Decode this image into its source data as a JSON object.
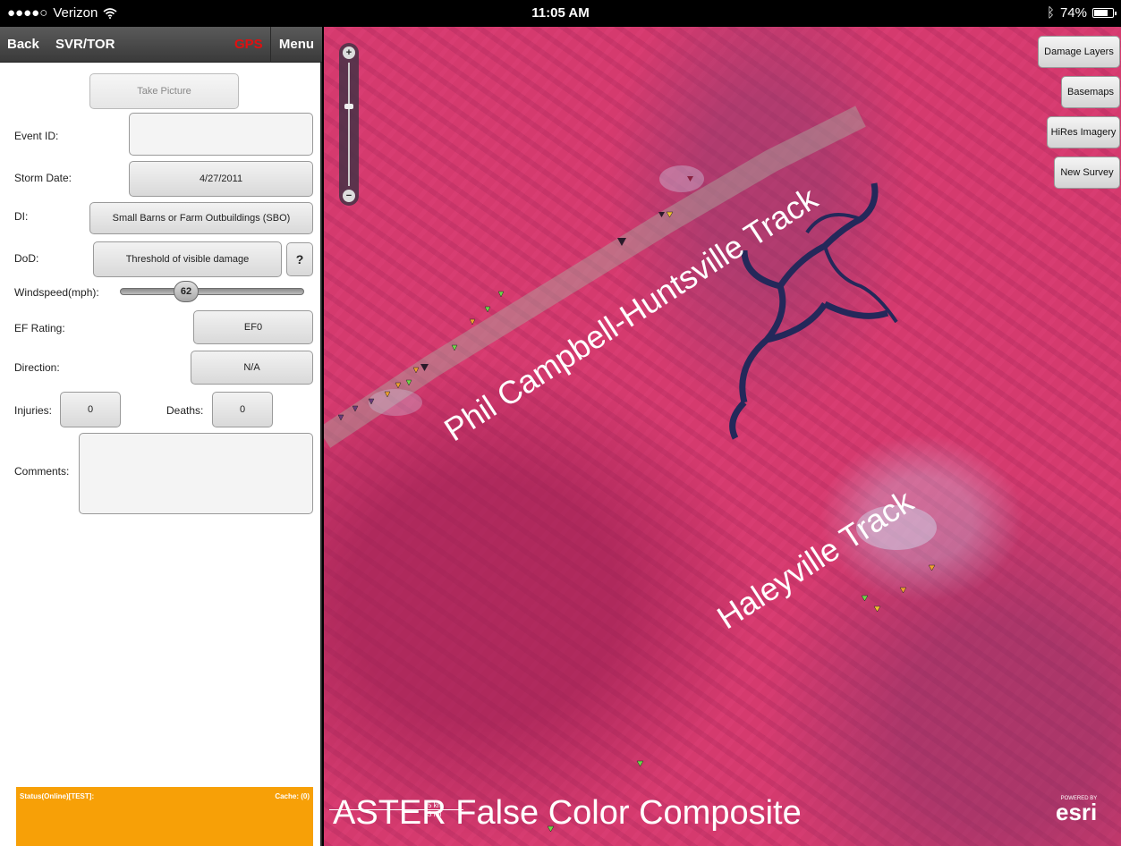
{
  "status_bar": {
    "signal": "●●●●○",
    "carrier": "Verizon",
    "wifi_icon": "wifi-icon",
    "time": "11:05 AM",
    "bluetooth": "ᛒ",
    "battery": "74%",
    "battery_level": 0.74
  },
  "nav": {
    "back": "Back",
    "title": "SVR/TOR",
    "gps": "GPS",
    "menu": "Menu"
  },
  "form": {
    "take_picture": "Take Picture",
    "event_id_label": "Event ID:",
    "event_id_value": "",
    "storm_date_label": "Storm Date:",
    "storm_date_value": "4/27/2011",
    "di_label": "DI:",
    "di_value": "Small Barns or Farm Outbuildings (SBO)",
    "dod_label": "DoD:",
    "dod_value": "Threshold of visible damage",
    "dod_help": "?",
    "windspeed_label": "Windspeed(mph):",
    "windspeed_value": "62",
    "ef_label": "EF Rating:",
    "ef_value": "EF0",
    "direction_label": "Direction:",
    "direction_value": "N/A",
    "injuries_label": "Injuries:",
    "injuries_value": "0",
    "deaths_label": "Deaths:",
    "deaths_value": "0",
    "comments_label": "Comments:",
    "comments_value": ""
  },
  "footer": {
    "status": "Status(Online)[TEST]:",
    "cache": "Cache: (0)",
    "color": "#f7a007"
  },
  "map": {
    "buttons": {
      "damage_layers": "Damage Layers",
      "basemaps": "Basemaps",
      "hires": "HiRes Imagery",
      "new_survey": "New Survey"
    },
    "track1": "Phil Campbell-Huntsville Track",
    "track2": "Haleyville Track",
    "caption": "ASTER False Color Composite",
    "scale_km": "5 km",
    "scale_mi": "3 mi",
    "esri_powered": "POWERED BY",
    "esri_brand": "esri",
    "colors": {
      "vegetation": "#d53a6e",
      "water": "#1f2a55",
      "marker_green": "#6fd64a",
      "marker_orange": "#f0a030",
      "marker_dark": "#2a1a2a"
    }
  }
}
